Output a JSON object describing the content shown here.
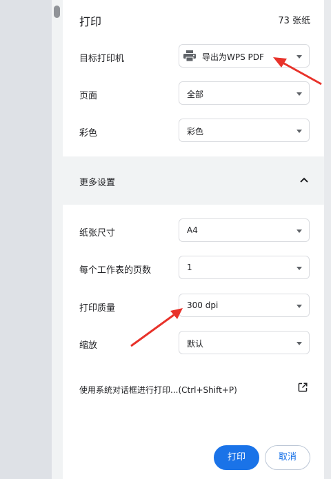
{
  "header": {
    "title": "打印",
    "sheet_count": "73 张纸"
  },
  "settings": {
    "printer": {
      "label": "目标打印机",
      "value": "导出为WPS PDF",
      "icon": "printer-icon"
    },
    "pages": {
      "label": "页面",
      "value": "全部"
    },
    "color": {
      "label": "彩色",
      "value": "彩色"
    }
  },
  "more_settings": {
    "label": "更多设置",
    "icon": "chevron-up-icon"
  },
  "advanced": {
    "paper_size": {
      "label": "纸张尺寸",
      "value": "A4"
    },
    "pages_per_sheet": {
      "label": "每个工作表的页数",
      "value": "1"
    },
    "quality": {
      "label": "打印质量",
      "value": "300 dpi"
    },
    "scale": {
      "label": "缩放",
      "value": "默认"
    }
  },
  "system_dialog": {
    "label": "使用系统对话框进行打印...(Ctrl+Shift+P)",
    "icon": "open-in-new-icon"
  },
  "buttons": {
    "print": "打印",
    "cancel": "取消"
  },
  "colors": {
    "accent": "#1a73e8",
    "annotation_arrow": "#e8322a"
  }
}
